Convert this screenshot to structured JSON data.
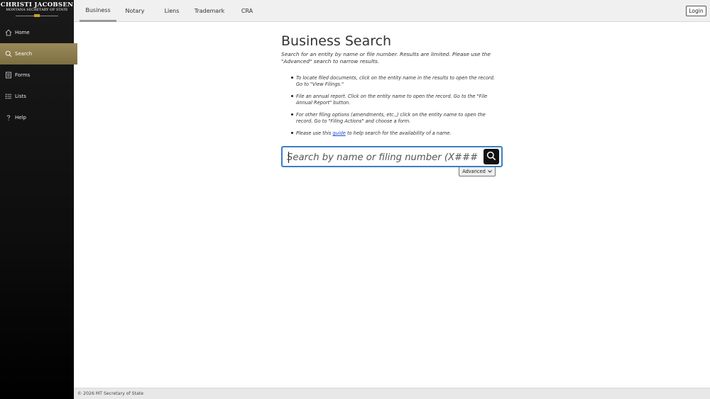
{
  "logo": {
    "line1": "Christi Jacobsen",
    "line2": "Montana Secretary of State"
  },
  "sidebar": {
    "items": [
      {
        "label": "Home",
        "icon": "home-icon"
      },
      {
        "label": "Search",
        "icon": "search-icon",
        "active": true
      },
      {
        "label": "Forms",
        "icon": "forms-icon"
      },
      {
        "label": "Lists",
        "icon": "list-icon"
      },
      {
        "label": "Help",
        "icon": "help-icon"
      }
    ]
  },
  "topnav": {
    "tabs": [
      "Business",
      "Notary",
      "Liens",
      "Trademark",
      "CRA"
    ],
    "active": "Business",
    "login_label": "Login"
  },
  "main": {
    "title": "Business Search",
    "subtitle": "Search for an entity by name or file number. Results are limited. Please use the \"Advanced\" search to narrow results.",
    "bullets": [
      "To locate filed documents, click on the entity name in the results to open the record. Go to \"View Filings.\"",
      "File an annual report. Click on the entity name to open the record. Go to the \"File Annual Report\" button.",
      "For other filing options (amendments, etc.,) click on the entity name to open the record. Go to \"Filing Actions\" and choose a form."
    ],
    "guide_bullet": {
      "before": "Please use this ",
      "link": "guide",
      "after": " to help search for the availability of a name."
    }
  },
  "search": {
    "value": "",
    "placeholder": "Search by name or filing number (X########)",
    "advanced_label": "Advanced"
  },
  "footer": {
    "text": "© 2026 MT Secretary of State"
  },
  "colors": {
    "accent_border": "#3b7fc4",
    "active_nav": "#8a7a4e",
    "link": "#1a4fc9"
  }
}
